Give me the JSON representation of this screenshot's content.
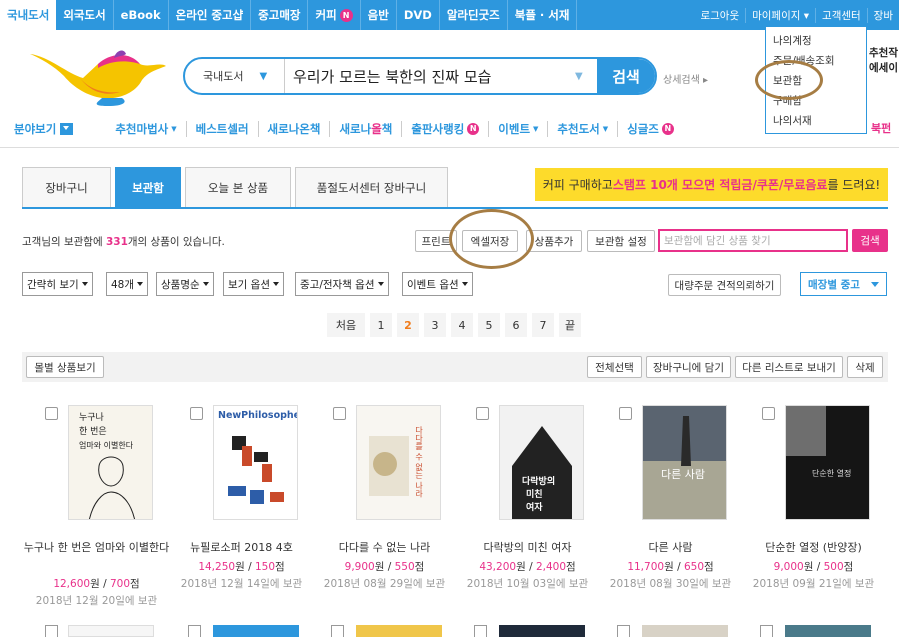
{
  "topnav": {
    "tabs": [
      {
        "label": "국내도서",
        "active": true
      },
      {
        "label": "외국도서"
      },
      {
        "label": "eBook"
      },
      {
        "label": "온라인 중고샵"
      },
      {
        "label": "중고매장"
      },
      {
        "label": "커피",
        "badge": "N"
      },
      {
        "label": "음반"
      },
      {
        "label": "DVD"
      },
      {
        "label": "알라딘굿즈"
      },
      {
        "label": "북플 · 서재"
      }
    ],
    "user_links": [
      "로그아웃",
      "마이페이지 ▾",
      "고객센터",
      "장바"
    ]
  },
  "mypage_menu": [
    "나의계정",
    "주문/배송조회",
    "보관함",
    "구매함",
    "나의서재"
  ],
  "search": {
    "category": "국내도서",
    "query": "우리가 모르는 북한의 진짜 모습",
    "button": "검색",
    "detail": "상세검색 ▸"
  },
  "promo": {
    "line1": "추천작",
    "line2": "에세이",
    "line3": "북펀"
  },
  "catnav": {
    "field_label": "분야보기",
    "items": [
      {
        "label": "추천마법사",
        "dropdown": true
      },
      {
        "label": "베스트셀러"
      },
      {
        "label": "새로나온책"
      },
      {
        "label_a": "새로나",
        "label_b": "올",
        "label_c": "책"
      },
      {
        "label": "출판사랭킹",
        "badge": "N"
      },
      {
        "label": "이벤트",
        "dropdown": true
      },
      {
        "label": "추천도서",
        "dropdown": true
      },
      {
        "label": "싱글즈",
        "badge": "N"
      }
    ]
  },
  "tabs": [
    "장바구니",
    "보관함",
    "오늘 본 상품",
    "품절도서센터 장바구니"
  ],
  "coffee_banner": {
    "pre": "커피 구매하고 ",
    "hl": "스탬프 10개 모으면 적립금/쿠폰/무료음료",
    "post": "를 드려요!"
  },
  "info": {
    "pre": "고객님의 보관함에 ",
    "count": "331",
    "post": "개의 상품이 있습니다."
  },
  "toolbar": {
    "print": "프린트",
    "excel": "엑셀저장",
    "add": "상품추가",
    "settings": "보관함 설정",
    "find_placeholder": "보관함에 담긴 상품 찾기",
    "find_button": "검색"
  },
  "filters": [
    "간략히 보기",
    "48개",
    "상품명순",
    "보기 옵션",
    "중고/전자책 옵션",
    "이벤트 옵션"
  ],
  "bulk_quote": "대량주문 견적의뢰하기",
  "store_used": "매장별 중고",
  "pager": [
    "처음",
    "1",
    "2",
    "3",
    "4",
    "5",
    "6",
    "7",
    "끝"
  ],
  "current_page": "2",
  "actions": {
    "by_item": "몰별 상품보기",
    "select_all": "전체선택",
    "to_cart": "장바구니에 담기",
    "to_list": "다른 리스트로 보내기",
    "delete": "삭제"
  },
  "books": [
    {
      "title": "누구나 한 번은 엄마와 이별한다",
      "price": "12,600",
      "points": "700",
      "saved": "2018년 12월 20일에 보관",
      "cover_text": "누구나 한 번은 엄마와 이별한다"
    },
    {
      "title": "뉴필로소퍼 2018 4호",
      "price": "14,250",
      "points": "150",
      "saved": "2018년 12월 14일에 보관",
      "cover_text": "NewPhilosopher"
    },
    {
      "title": "다다를 수 없는 나라",
      "price": "9,900",
      "points": "550",
      "saved": "2018년 08월 29일에 보관",
      "cover_text": "다다를 수 없는 나라"
    },
    {
      "title": "다락방의 미친 여자",
      "price": "43,200",
      "points": "2,400",
      "saved": "2018년 10월 03일에 보관",
      "cover_text": "다락방의 미친 여자"
    },
    {
      "title": "다른 사람",
      "price": "11,700",
      "points": "650",
      "saved": "2018년 08월 30일에 보관",
      "cover_text": "다른 사람"
    },
    {
      "title": "단순한 열정 (반양장)",
      "price": "9,000",
      "points": "500",
      "saved": "2018년 09월 21일에 보관",
      "cover_text": "단순한 열정"
    }
  ],
  "units": {
    "won": "원",
    "points": "점",
    "sep": " / "
  }
}
